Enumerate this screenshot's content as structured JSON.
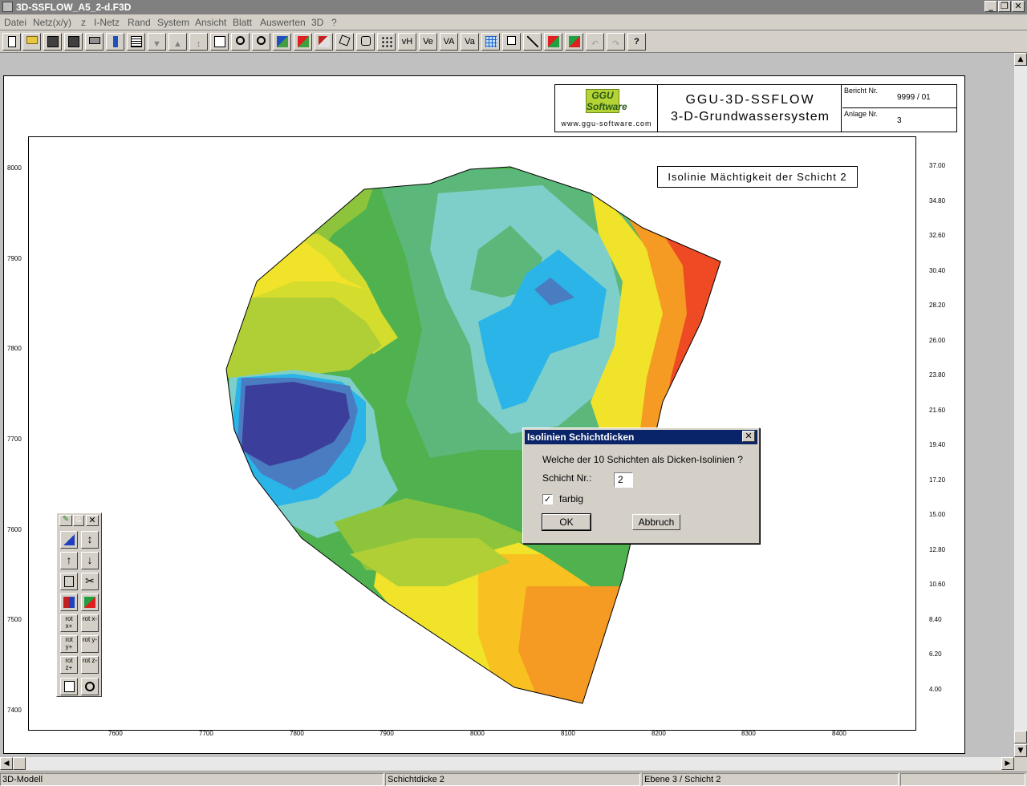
{
  "window": {
    "title": "3D-SSFLOW_A5_2-d.F3D",
    "min": "_",
    "restore": "❐",
    "close": "✕"
  },
  "menu": [
    "Datei",
    "Netz(x/y)",
    "z",
    "I-Netz",
    "Rand",
    "System",
    "Ansicht",
    "Blatt",
    "Auswerten",
    "3D",
    "?"
  ],
  "toolbar": {
    "labels": [
      "vH",
      "Ve",
      "VA",
      "Va",
      "?"
    ]
  },
  "titleblock": {
    "logo_text": "GGU Software",
    "url": "www.ggu-software.com",
    "program": "GGU-3D-SSFLOW",
    "subtitle": "3-D-Grundwassersystem",
    "report_label": "Bericht Nr.",
    "report_value": "9999 / 01",
    "annex_label": "Anlage Nr.",
    "annex_value": "3"
  },
  "plot_title": "Isolinie Mächtigkeit der Schicht 2",
  "chart_data": {
    "type": "heatmap",
    "title": "Isolinie Mächtigkeit der Schicht 2",
    "x_ticks": [
      "7600",
      "7700",
      "7800",
      "7900",
      "8000",
      "8100",
      "8200",
      "8300",
      "8400"
    ],
    "y_ticks": [
      "8000",
      "7900",
      "7800",
      "7700",
      "7600",
      "7500",
      "7400"
    ],
    "xlim": [
      7490,
      8470
    ],
    "ylim": [
      7382,
      8037
    ],
    "legend": {
      "placement": "right",
      "levels": [
        "37.00",
        "34.80",
        "32.60",
        "30.40",
        "28.20",
        "26.00",
        "23.80",
        "21.60",
        "19.40",
        "17.20",
        "15.00",
        "12.80",
        "10.60",
        "8.40",
        "6.20",
        "4.00"
      ],
      "colors": [
        "#3b3f9b",
        "#4a7cc2",
        "#2ab4e8",
        "#7ecfc9",
        "#6fc6a8",
        "#5cb87a",
        "#4fb24f",
        "#6ab841",
        "#8dc43c",
        "#b0cf36",
        "#d4dc2e",
        "#f0e32a",
        "#f8c020",
        "#f59a22",
        "#f27a24",
        "#ee4a24"
      ]
    }
  },
  "palette": {
    "tabs": [
      "G",
      "✕"
    ],
    "rot": [
      "rot x+",
      "rot x-",
      "rot y+",
      "rot y-",
      "rot z+",
      "rot z-"
    ]
  },
  "dialog": {
    "title": "Isolinien Schichtdicken",
    "question": "Welche der 10 Schichten als Dicken-Isolinien ?",
    "layer_label": "Schicht Nr.:",
    "layer_value": "2",
    "check_label": "farbig",
    "check_mark": "✓",
    "ok": "OK",
    "cancel": "Abbruch",
    "close": "✕"
  },
  "status": [
    "3D-Modell",
    "Schichtdicke 2",
    "Ebene 3 / Schicht 2"
  ]
}
